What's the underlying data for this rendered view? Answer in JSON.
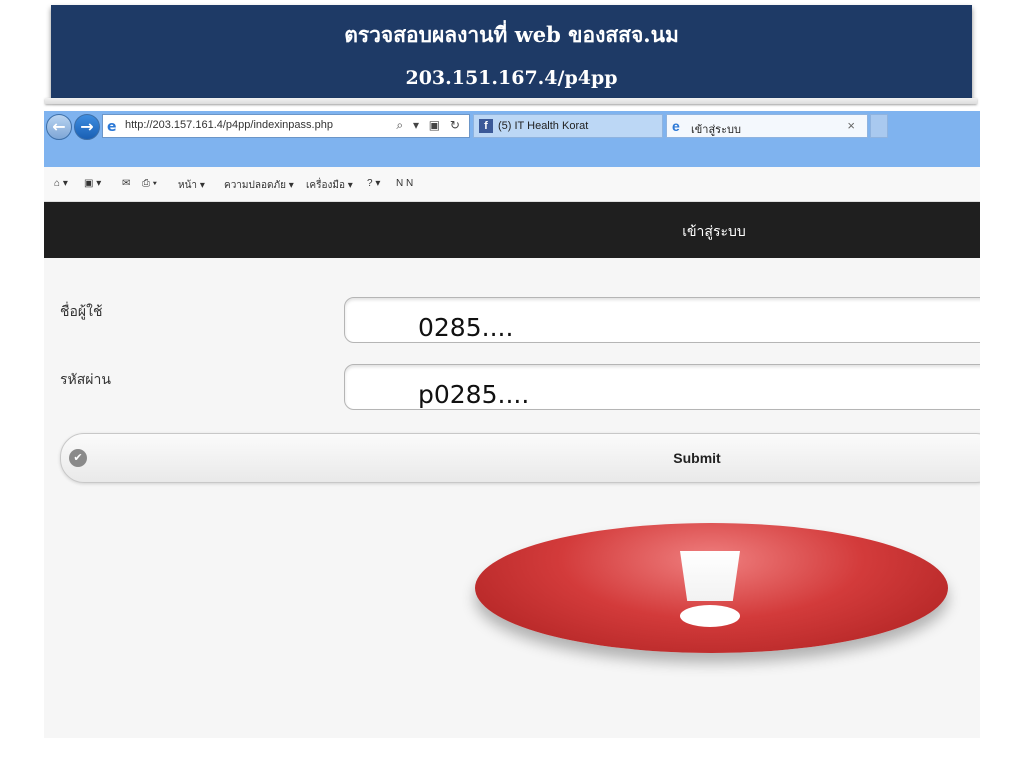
{
  "slide": {
    "title_line1": "ตรวจสอบผลงานที่ web ของสสจ.นม",
    "title_line2": "203.151.167.4/p4pp"
  },
  "browser": {
    "address_url": "http://203.157.161.4/p4pp/indexinpass.php",
    "address_icons": "⌕ ▾ ▣ ↻",
    "tabs": [
      {
        "label": "(5) IT Health Korat",
        "icon": "facebook-icon"
      },
      {
        "label": "เข้าสู่ระบบ",
        "icon": "ie-icon",
        "close": "×"
      }
    ],
    "command_bar": {
      "home": "⌂ ▾",
      "feeds": "▣ ▾",
      "mail": "✉",
      "print": "⎙ ▾",
      "page": "หน้า ▾",
      "safety": "ความปลอดภัย ▾",
      "tools": "เครื่องมือ ▾",
      "help": "? ▾",
      "ext": "N N"
    }
  },
  "page": {
    "header_title": "เข้าสู่ระบบ",
    "username_label": "ชื่อผู้ใช้",
    "username_value": "0285....",
    "password_label": "รหัสผ่าน",
    "password_value": "p0285....",
    "submit_label": "Submit",
    "check_icon": "✔"
  },
  "alert_icon": "exclamation-icon"
}
